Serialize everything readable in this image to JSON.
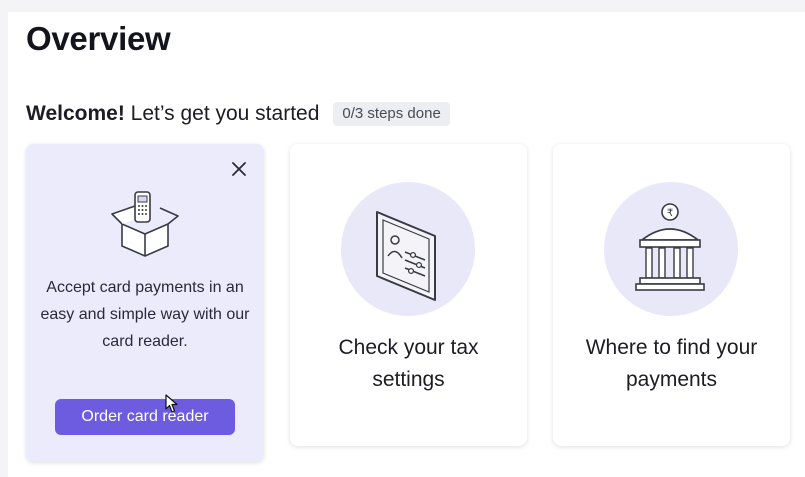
{
  "page": {
    "title": "Overview"
  },
  "welcome": {
    "bold": "Welcome!",
    "text": " Let’s get you started",
    "steps_badge": "0/3 steps done"
  },
  "cards": [
    {
      "description": "Accept card payments in an easy and simple way with our card reader.",
      "button_label": "Order card reader",
      "icon": "card-reader-box-icon",
      "close_icon": "close-icon"
    },
    {
      "label": "Check your tax settings",
      "icon": "tax-settings-document-icon"
    },
    {
      "label": "Where to find your payments",
      "icon": "bank-building-icon"
    }
  ],
  "colors": {
    "accent": "#6d5ce0",
    "active_card_bg": "#ecebfb",
    "illustration_circle": "#e9e8f8",
    "badge_bg": "#eceef1"
  }
}
